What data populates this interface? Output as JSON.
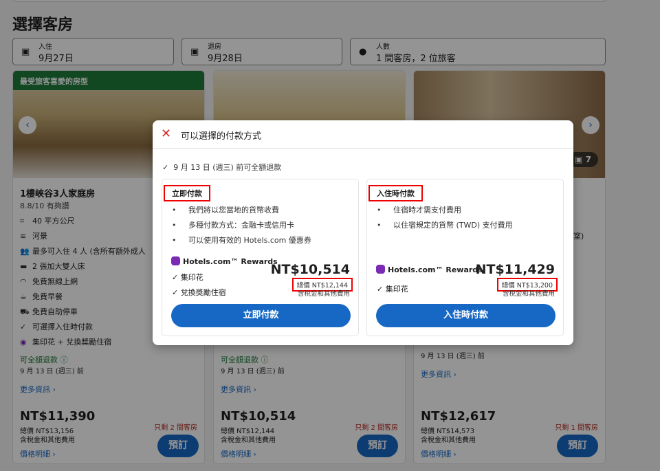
{
  "page": {
    "title": "選擇客房"
  },
  "search": {
    "checkin": {
      "label": "入住",
      "value": "9月27日"
    },
    "checkout": {
      "label": "退房",
      "value": "9月28日"
    },
    "guests": {
      "label": "人數",
      "value": "1 間客房，2 位旅客"
    }
  },
  "cards": [
    {
      "badge": "最受旅客喜愛的房型",
      "name": "1樓峽谷3人家庭房",
      "rating": "8.8/10 有夠讚",
      "features": [
        {
          "icon": "area-icon",
          "text": "40 平方公尺"
        },
        {
          "icon": "view-icon",
          "text": "河景"
        },
        {
          "icon": "people-icon",
          "text": "最多可入住 4 人 (含所有額外成人"
        },
        {
          "icon": "bed-icon",
          "text": "2 張加大雙人床"
        },
        {
          "icon": "wifi-icon",
          "text": "免費無線上網"
        },
        {
          "icon": "coffee-icon",
          "text": "免費早餐"
        },
        {
          "icon": "car-icon",
          "text": "免費自助停車"
        },
        {
          "icon": "check-icon",
          "text": "可選擇入住時付款"
        }
      ],
      "rewards": "集印花 + 兌換獎勵住宿",
      "refund": "可全額退款",
      "refund_date": "9 月 13 日 (週三) 前",
      "more": "更多資訊",
      "price": "NT$11,390",
      "total": "總價 NT$13,156",
      "tax": "含稅金和其他費用",
      "details": "價格明細",
      "left": "只剩 2 間客房",
      "book": "預訂"
    },
    {
      "refund": "可全額退款",
      "refund_date": "9 月 13 日 (週三) 前",
      "more": "更多資訊",
      "price": "NT$10,514",
      "total": "總價 NT$12,144",
      "tax": "含稅金和其他費用",
      "details": "價格明細",
      "left": "只剩 2 間客房",
      "book": "預訂"
    },
    {
      "photo_count": "7",
      "partial_text": "室)",
      "refund_date": "9 月 13 日 (週三) 前",
      "more": "更多資訊",
      "price": "NT$12,617",
      "total": "總價 NT$14,573",
      "tax": "含稅金和其他費用",
      "details": "價格明細",
      "left": "只剩 1 間客房",
      "book": "預訂"
    }
  ],
  "modal": {
    "title": "可以選擇的付款方式",
    "refund": "9 月 13 日 (週三) 前可全額退款",
    "options": [
      {
        "title": "立即付款",
        "bullets": [
          "我們將以您當地的貨幣收費",
          "多種付款方式：金融卡或信用卡",
          "可以使用有效的 Hotels.com 優惠券"
        ],
        "rewards": "Hotels.com™ Rewards",
        "perks": [
          "集印花",
          "兌換獎勵住宿"
        ],
        "price": "NT$10,514",
        "total": "總價 NT$12,144",
        "tax": "含稅金和其他費用",
        "button": "立即付款"
      },
      {
        "title": "入住時付款",
        "bullets": [
          "住宿時才需支付費用",
          "以住宿規定的貨幣 (TWD) 支付費用"
        ],
        "rewards": "Hotels.com™ Rewards",
        "perks": [
          "集印花"
        ],
        "price": "NT$11,429",
        "total": "總價 NT$13,200",
        "tax": "含稅金和其他費用",
        "button": "入住時付款"
      }
    ]
  },
  "colors": {
    "accent": "#1668c4",
    "highlight": "#e00000",
    "rewards": "#7a2ab3",
    "refund": "#227a3a"
  }
}
